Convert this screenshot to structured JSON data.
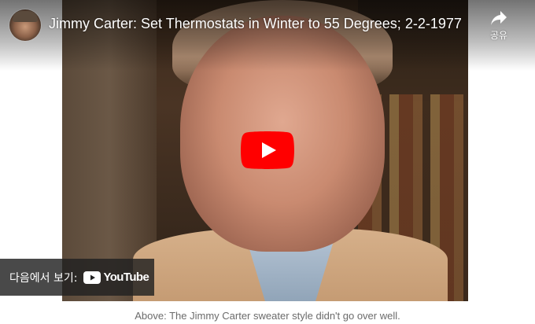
{
  "video": {
    "title": "Jimmy Carter: Set Thermostats in Winter to 55 Degrees; 2-2-1977",
    "share_label": "공유",
    "watch_on_label": "다음에서 보기:",
    "youtube_wordmark": "YouTube",
    "play_icon": "play-icon",
    "share_icon": "share-icon"
  },
  "caption": "Above: The Jimmy Carter sweater style didn't go over well.",
  "colors": {
    "play_red": "#ff0000",
    "overlay": "#212121"
  }
}
